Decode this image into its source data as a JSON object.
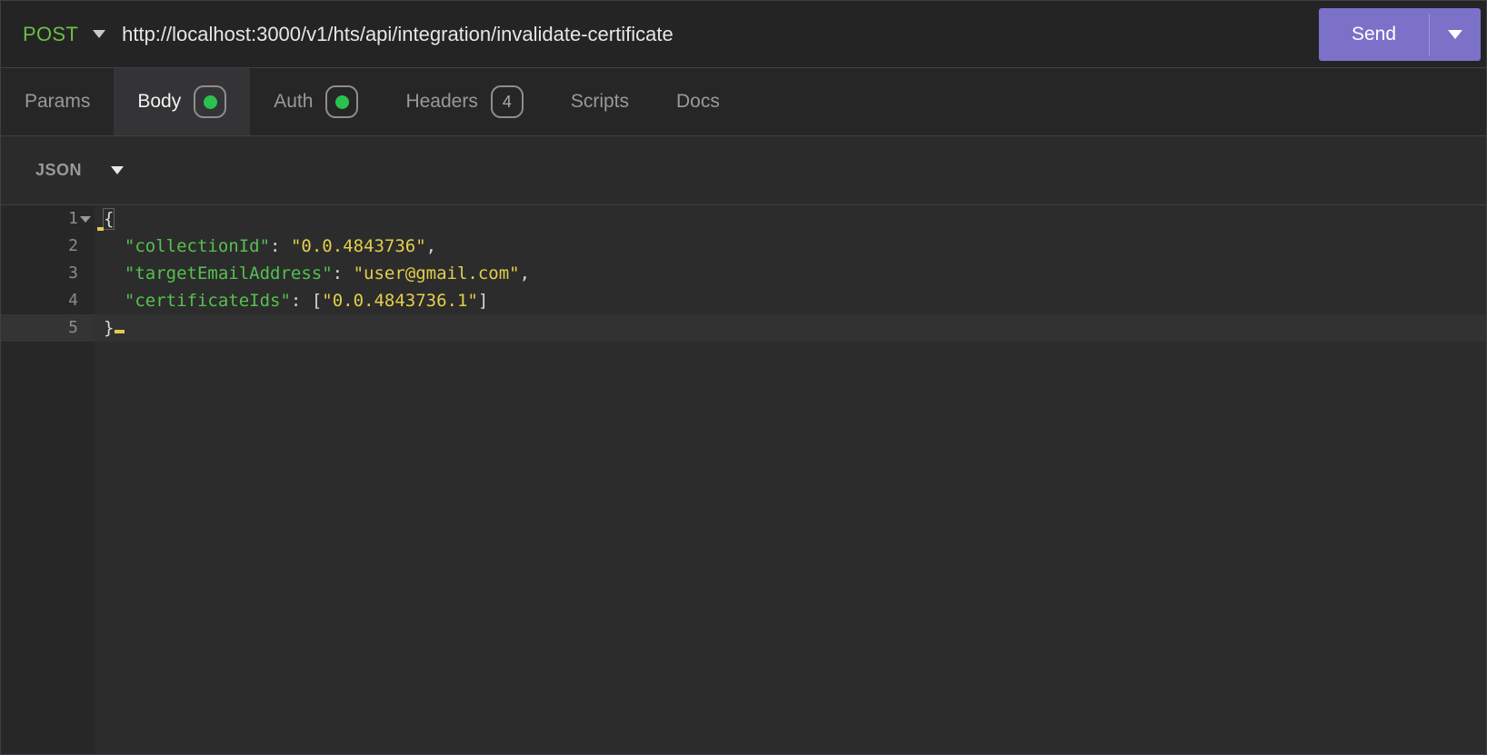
{
  "request_bar": {
    "method": "POST",
    "url": "http://localhost:3000/v1/hts/api/integration/invalidate-certificate",
    "send_label": "Send"
  },
  "tabs": [
    {
      "label": "Params",
      "badge": null,
      "active": false
    },
    {
      "label": "Body",
      "badge": "dot",
      "active": true
    },
    {
      "label": "Auth",
      "badge": "dot",
      "active": false
    },
    {
      "label": "Headers",
      "badge": "4",
      "active": false
    },
    {
      "label": "Scripts",
      "badge": null,
      "active": false
    },
    {
      "label": "Docs",
      "badge": null,
      "active": false
    }
  ],
  "format_bar": {
    "selected": "JSON"
  },
  "editor": {
    "line_numbers": [
      "1",
      "2",
      "3",
      "4",
      "5"
    ],
    "code": {
      "line1": {
        "open_brace": "{"
      },
      "line2": {
        "indent": "  ",
        "key": "\"collectionId\"",
        "colon": ": ",
        "value": "\"0.0.4843736\"",
        "comma": ","
      },
      "line3": {
        "indent": "  ",
        "key": "\"targetEmailAddress\"",
        "colon": ": ",
        "value": "\"user@gmail.com\"",
        "comma": ","
      },
      "line4": {
        "indent": "  ",
        "key": "\"certificateIds\"",
        "colon": ": ",
        "open_bracket": "[",
        "value": "\"0.0.4843736.1\"",
        "close_bracket": "]"
      },
      "line5": {
        "close_brace": "}"
      }
    }
  },
  "colors": {
    "method_green": "#6cbe44",
    "send_purple": "#7b71c8",
    "badge_dot_green": "#2bc14e",
    "json_key_green": "#56c14e",
    "json_string_yellow": "#e2cf4b",
    "editor_bg": "#2c2c2d",
    "panel_bg": "#262627"
  }
}
